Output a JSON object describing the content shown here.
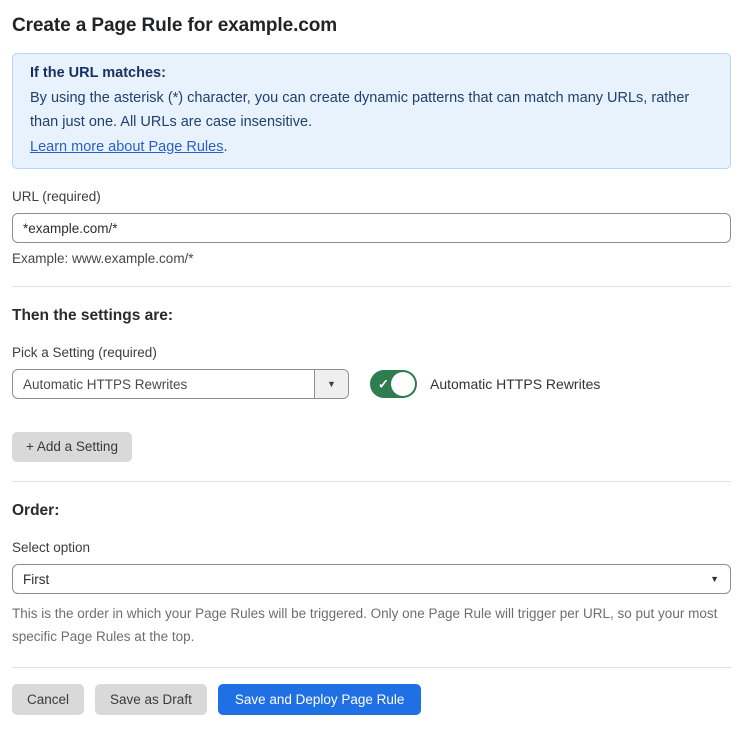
{
  "page": {
    "title": "Create a Page Rule for example.com"
  },
  "info_box": {
    "heading": "If the URL matches:",
    "body": "By using the asterisk (*) character, you can create dynamic patterns that can match many URLs, rather than just one. All URLs are case insensitive.",
    "link_label": "Learn more about Page Rules",
    "link_suffix": "."
  },
  "url_field": {
    "label": "URL (required)",
    "value": "*example.com/*",
    "helper": "Example: www.example.com/*"
  },
  "settings": {
    "heading": "Then the settings are:",
    "picker_label": "Pick a Setting (required)",
    "picker_value": "Automatic HTTPS Rewrites",
    "toggle_label": "Automatic HTTPS Rewrites",
    "toggle_state": "on",
    "add_button_label": "+ Add a Setting"
  },
  "order": {
    "heading": "Order:",
    "select_label": "Select option",
    "select_value": "First",
    "helper": "This is the order in which your Page Rules will be triggered. Only one Page Rule will trigger per URL, so put your most specific Page Rules at the top."
  },
  "actions": {
    "cancel_label": "Cancel",
    "save_draft_label": "Save as Draft",
    "save_deploy_label": "Save and Deploy Page Rule"
  },
  "icons": {
    "dropdown_caret": "▼",
    "toggle_check": "✓"
  },
  "colors": {
    "primary_blue": "#1f6fe5",
    "info_bg": "#e8f2fc",
    "info_border": "#b8d4f0",
    "info_text": "#1e3c6e",
    "link_blue": "#2b5fc7",
    "toggle_green": "#2e7d4f",
    "button_gray": "#d9d9d9"
  }
}
